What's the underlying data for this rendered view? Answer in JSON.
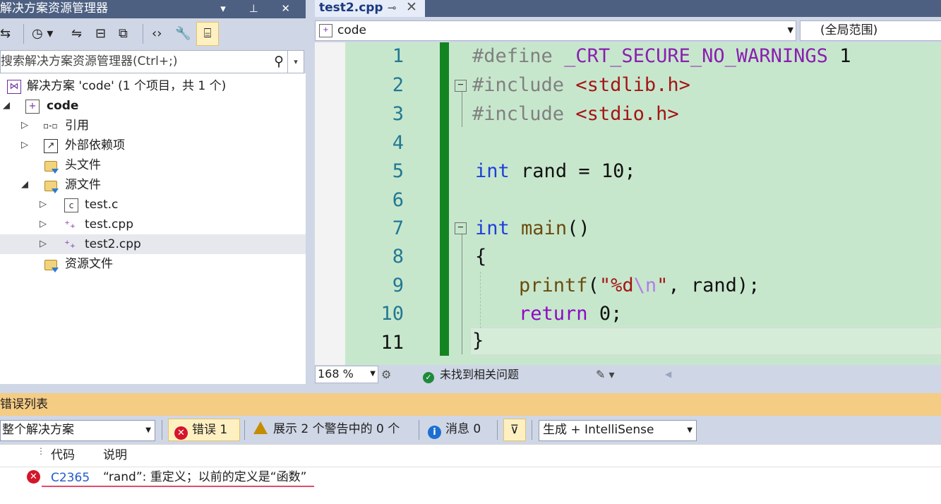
{
  "solution_explorer": {
    "title": "解决方案资源管理器",
    "title_buttons": "▾ ⊥ ✕",
    "search_placeholder": "搜索解决方案资源管理器(Ctrl+;)",
    "tree": {
      "solution": "解决方案 'code' (1 个项目，共 1 个)",
      "project": "code",
      "references": "引用",
      "external_deps": "外部依赖项",
      "header_files": "头文件",
      "source_files": "源文件",
      "files": [
        "test.c",
        "test.cpp",
        "test2.cpp"
      ],
      "resource_files": "资源文件"
    }
  },
  "editor": {
    "tab_title": "test2.cpp",
    "nav_project": "code",
    "nav_scope": "(全局范围)",
    "line_numbers": [
      "1",
      "2",
      "3",
      "4",
      "5",
      "6",
      "7",
      "8",
      "9",
      "10",
      "11"
    ],
    "code": {
      "l1_pp": "#define",
      "l1_macro": "_CRT_SECURE_NO_WARNINGS",
      "l1_val": "1",
      "l2_pp": "#include",
      "l2_inc": "<stdlib.h>",
      "l3_pp": "#include",
      "l3_inc": "<stdio.h>",
      "l5_kw": "int",
      "l5_rest": "rand = 10;",
      "l7_kw": "int",
      "l7_fn": "main",
      "l7_rest": "()",
      "l8": "{",
      "l9_fn": "printf",
      "l9_open": "(",
      "l9_str1": "\"%d",
      "l9_esc": "\\n",
      "l9_str2": "\"",
      "l9_rest": ", rand);",
      "l10_kw": "return",
      "l10_rest": "0;",
      "l11": "}"
    },
    "zoom": "168 %",
    "status": "未找到相关问题"
  },
  "error_list": {
    "title": "错误列表",
    "scope": "整个解决方案",
    "errors_label": "错误 1",
    "warnings_label": "展示 2 个警告中的 0 个",
    "messages_label": "消息 0",
    "build_filter": "生成 + IntelliSense",
    "col_code": "代码",
    "col_desc": "说明",
    "rows": [
      {
        "code": "C2365",
        "desc": "“rand”: 重定义；以前的定义是“函数”"
      }
    ]
  }
}
